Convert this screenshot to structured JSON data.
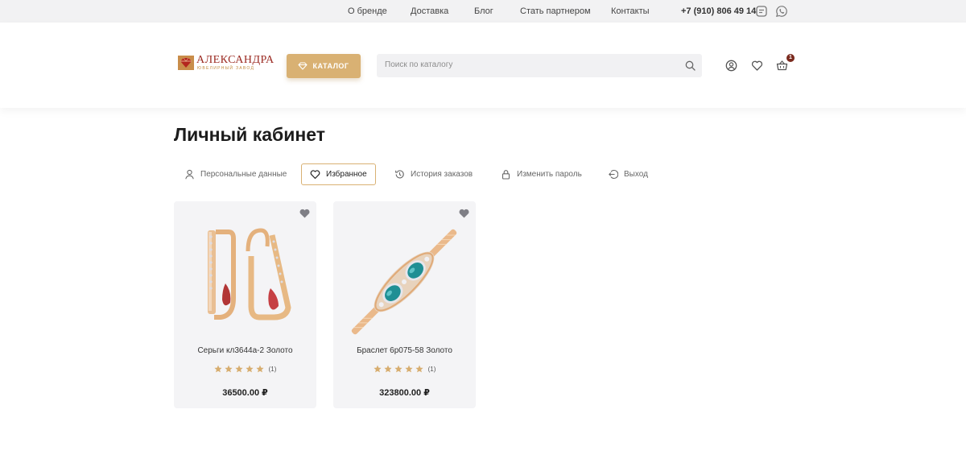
{
  "topbar": {
    "nav": [
      "О бренде",
      "Доставка",
      "Блог",
      "Стать партнером",
      "Контакты"
    ],
    "phone": "+7 (910) 806 49 14",
    "icons": [
      "chat-icon",
      "whatsapp-icon"
    ]
  },
  "header": {
    "logo": {
      "name": "АЛЕКСАНДРА",
      "subtitle": "ЮВЕЛИРНЫЙ ЗАВОД"
    },
    "catalog_label": "КАТАЛОГ",
    "search_placeholder": "Поиск по каталогу",
    "cart_count": "1",
    "icons": [
      "user-icon",
      "heart-icon",
      "cart-icon"
    ]
  },
  "colors": {
    "accent": "#d9b173",
    "badge": "#7a2a1e",
    "star": "#d7ad6f"
  },
  "page": {
    "title": "Личный кабинет",
    "tabs": [
      {
        "label": "Персональные данные",
        "icon": "user-icon",
        "active": false
      },
      {
        "label": "Избранное",
        "icon": "heart-icon",
        "active": true
      },
      {
        "label": "История заказов",
        "icon": "history-icon",
        "active": false
      },
      {
        "label": "Изменить пароль",
        "icon": "lock-icon",
        "active": false
      },
      {
        "label": "Выход",
        "icon": "logout-icon",
        "active": false
      }
    ]
  },
  "products": [
    {
      "name": "Серьги кл3644а-2 Золото",
      "rating": 5,
      "reviews": "(1)",
      "price": "36500.00 ₽"
    },
    {
      "name": "Браслет 6р075-58 Золото",
      "rating": 5,
      "reviews": "(1)",
      "price": "323800.00 ₽"
    }
  ]
}
